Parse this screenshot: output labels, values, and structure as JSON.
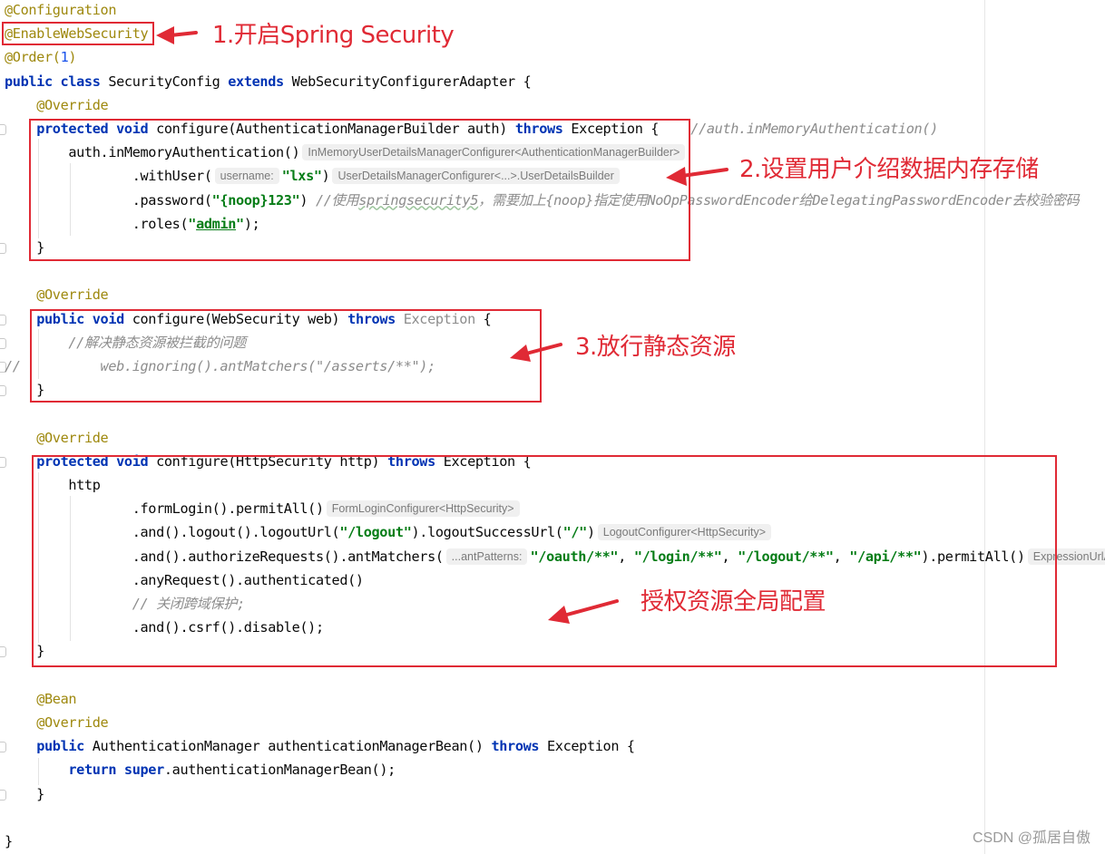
{
  "code": {
    "lines": [
      [
        {
          "t": "@Configuration",
          "c": "ann"
        }
      ],
      [
        {
          "t": "@EnableWebSecurity",
          "c": "ann"
        }
      ],
      [
        {
          "t": "@Order(",
          "c": "ann"
        },
        {
          "t": "1",
          "c": "num"
        },
        {
          "t": ")",
          "c": "ann"
        }
      ],
      [
        {
          "t": "public class ",
          "c": "kw"
        },
        {
          "t": "SecurityConfig "
        },
        {
          "t": "extends ",
          "c": "kw"
        },
        {
          "t": "WebSecurityConfigurerAdapter {"
        }
      ],
      [
        {
          "t": "    "
        },
        {
          "t": "@Override",
          "c": "ann"
        }
      ],
      [
        {
          "t": "    "
        },
        {
          "t": "protected void ",
          "c": "kw"
        },
        {
          "t": "configure(AuthenticationManagerBuilder auth) "
        },
        {
          "t": "throws ",
          "c": "kw"
        },
        {
          "t": "Exception {    "
        },
        {
          "t": "//auth.inMemoryAuthentication()",
          "c": "cmt"
        }
      ],
      [
        {
          "t": "        auth.inMemoryAuthentication()"
        },
        {
          "hint": "InMemoryUserDetailsManagerConfigurer<AuthenticationManagerBuilder>"
        }
      ],
      [
        {
          "t": "                .withUser("
        },
        {
          "hint": "username:"
        },
        {
          "t": "\"lxs\"",
          "c": "str"
        },
        {
          "t": ")"
        },
        {
          "hint": "UserDetailsManagerConfigurer<...>.UserDetailsBuilder"
        }
      ],
      [
        {
          "t": "                .password("
        },
        {
          "t": "\"{noop}123\"",
          "c": "str"
        },
        {
          "t": ") "
        },
        {
          "t": "//使用",
          "c": "cmt"
        },
        {
          "t": "springsecurity5",
          "c": "cmt wavy"
        },
        {
          "t": "，需要加上{noop}指定使用NoOpPasswordEncoder给DelegatingPasswordEncoder去校验密码",
          "c": "cmt"
        }
      ],
      [
        {
          "t": "                .roles("
        },
        {
          "t": "\"",
          "c": "str"
        },
        {
          "t": "admin",
          "c": "str und"
        },
        {
          "t": "\"",
          "c": "str"
        },
        {
          "t": ");"
        }
      ],
      [
        {
          "t": "    }"
        }
      ],
      [
        {
          "t": ""
        }
      ],
      [
        {
          "t": "    "
        },
        {
          "t": "@Override",
          "c": "ann"
        }
      ],
      [
        {
          "t": "    "
        },
        {
          "t": "public void ",
          "c": "kw"
        },
        {
          "t": "configure(WebSecurity web) "
        },
        {
          "t": "throws ",
          "c": "kw"
        },
        {
          "t": "Exception ",
          "c": "gray"
        },
        {
          "t": "{"
        }
      ],
      [
        {
          "t": "        "
        },
        {
          "t": "//解决静态资源被拦截的问题",
          "c": "cmt"
        }
      ],
      [
        {
          "t": "//",
          "c": "cmt"
        },
        {
          "t": "          web.ignoring().antMatchers(\"/asserts/**\");",
          "c": "cmt"
        }
      ],
      [
        {
          "t": "    }"
        }
      ],
      [
        {
          "t": ""
        }
      ],
      [
        {
          "t": "    "
        },
        {
          "t": "@Override",
          "c": "ann"
        }
      ],
      [
        {
          "t": "    "
        },
        {
          "t": "protected void ",
          "c": "kw"
        },
        {
          "t": "configure(HttpSecurity http) "
        },
        {
          "t": "throws ",
          "c": "kw"
        },
        {
          "t": "Exception {"
        }
      ],
      [
        {
          "t": "        http"
        }
      ],
      [
        {
          "t": "                .formLogin().permitAll()"
        },
        {
          "hint": "FormLoginConfigurer<HttpSecurity>"
        }
      ],
      [
        {
          "t": "                .and().logout().logoutUrl("
        },
        {
          "t": "\"/logout\"",
          "c": "str"
        },
        {
          "t": ").logoutSuccessUrl("
        },
        {
          "t": "\"/\"",
          "c": "str"
        },
        {
          "t": ")"
        },
        {
          "hint": "LogoutConfigurer<HttpSecurity>"
        }
      ],
      [
        {
          "t": "                .and().authorizeRequests().antMatchers("
        },
        {
          "hint": "...antPatterns:"
        },
        {
          "t": "\"/oauth/**\"",
          "c": "str"
        },
        {
          "t": ", "
        },
        {
          "t": "\"/login/**\"",
          "c": "str"
        },
        {
          "t": ", "
        },
        {
          "t": "\"/logout/**\"",
          "c": "str"
        },
        {
          "t": ", "
        },
        {
          "t": "\"/api/**\"",
          "c": "str"
        },
        {
          "t": ").permitAll()"
        },
        {
          "hint": "ExpressionUrlAuthorizationConfigurer"
        }
      ],
      [
        {
          "t": "                .anyRequest().authenticated()"
        }
      ],
      [
        {
          "t": "                "
        },
        {
          "t": "// 关闭跨域保护;",
          "c": "cmt"
        }
      ],
      [
        {
          "t": "                .and().csrf().disable();"
        }
      ],
      [
        {
          "t": "    }"
        }
      ],
      [
        {
          "t": ""
        }
      ],
      [
        {
          "t": "    "
        },
        {
          "t": "@Bean",
          "c": "ann"
        }
      ],
      [
        {
          "t": "    "
        },
        {
          "t": "@Override",
          "c": "ann"
        }
      ],
      [
        {
          "t": "    "
        },
        {
          "t": "public ",
          "c": "kw"
        },
        {
          "t": "AuthenticationManager authenticationManagerBean() "
        },
        {
          "t": "throws ",
          "c": "kw"
        },
        {
          "t": "Exception {"
        }
      ],
      [
        {
          "t": "        "
        },
        {
          "t": "return super",
          "c": "kw"
        },
        {
          "t": ".authenticationManagerBean();"
        }
      ],
      [
        {
          "t": "    }"
        }
      ],
      [
        {
          "t": ""
        }
      ],
      [
        {
          "t": "}"
        }
      ]
    ]
  },
  "annotations": {
    "note1": "1.开启Spring Security",
    "note2": "2.设置用户介绍数据内存存储",
    "note3": "3.放行静态资源",
    "note4": "授权资源全局配置"
  },
  "colors": {
    "highlight_red": "#e02a35",
    "keyword": "#0033b3",
    "annotation": "#9e880d",
    "string": "#067d17",
    "comment": "#8c8c8c"
  },
  "watermark": "CSDN @孤居自傲"
}
